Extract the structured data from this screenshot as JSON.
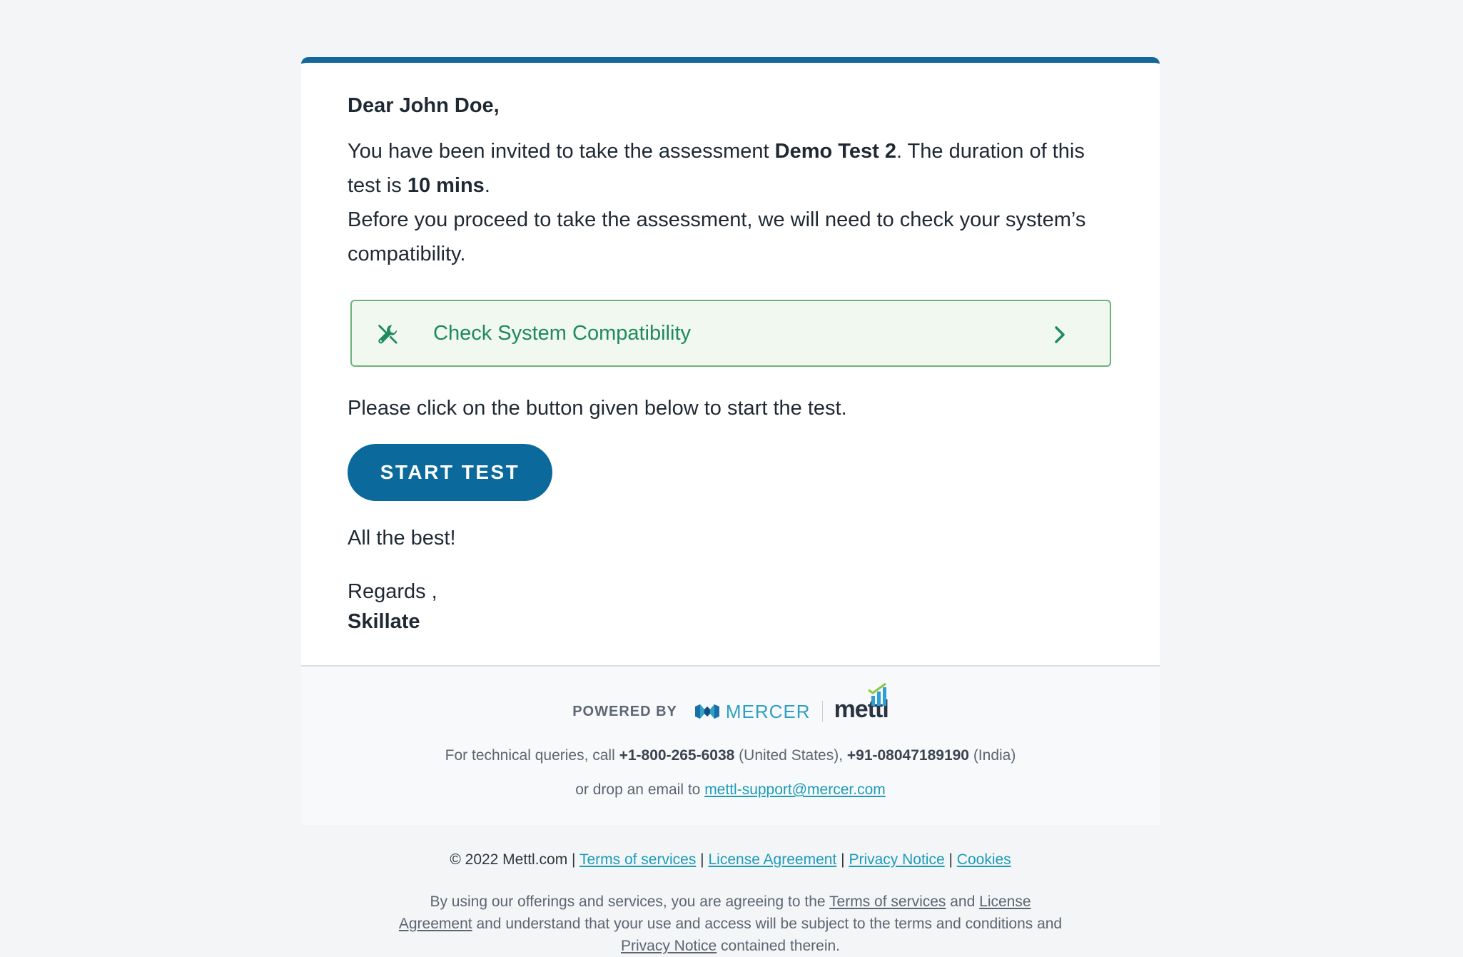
{
  "email": {
    "greeting": "Dear John Doe,",
    "intro": {
      "part1": "You have been invited to take the assessment ",
      "assessment_name": "Demo Test 2",
      "part2": ". The duration of this test is ",
      "duration": "10 mins",
      "part3": ".",
      "line2": "Before you proceed to take the assessment, we will need to check your system’s compatibility."
    },
    "compat_button": {
      "label": "Check System Compatibility",
      "icon": "tools-icon",
      "chevron": "chevron-right-icon"
    },
    "instruction": "Please click on the button given below to start the test.",
    "start_button": "START TEST",
    "closing": "All the best!",
    "regards": "Regards ,",
    "signature": "Skillate"
  },
  "footer": {
    "powered_by": "POWERED BY",
    "mercer_logo": "MERCER",
    "mettl_logo": "mettl",
    "tech_prefix": "For technical queries, call ",
    "phone_us": "+1-800-265-6038",
    "us_label": " (United States), ",
    "phone_india": "+91-08047189190",
    "india_label": " (India)",
    "email_prefix": "or drop an email to ",
    "support_email": "mettl-support@mercer.com"
  },
  "legal": {
    "copyright": "© 2022 Mettl.com | ",
    "links": [
      "Terms of services",
      "License Agreement",
      "Privacy Notice",
      "Cookies"
    ],
    "separator": "|",
    "agree_prefix": "By using our offerings and services, you are agreeing to the ",
    "agree_terms": "Terms of services",
    "agree_and": " and ",
    "agree_license": "License Agreement",
    "agree_middle": " and understand that your use and access will be subject to the terms and conditions and ",
    "agree_privacy": "Privacy Notice",
    "agree_suffix": " contained therein."
  },
  "colors": {
    "brand_blue": "#0b6a9b",
    "compat_green": "#1f8a5b",
    "compat_border": "#6cb47b",
    "link_teal": "#1d9cb8"
  }
}
